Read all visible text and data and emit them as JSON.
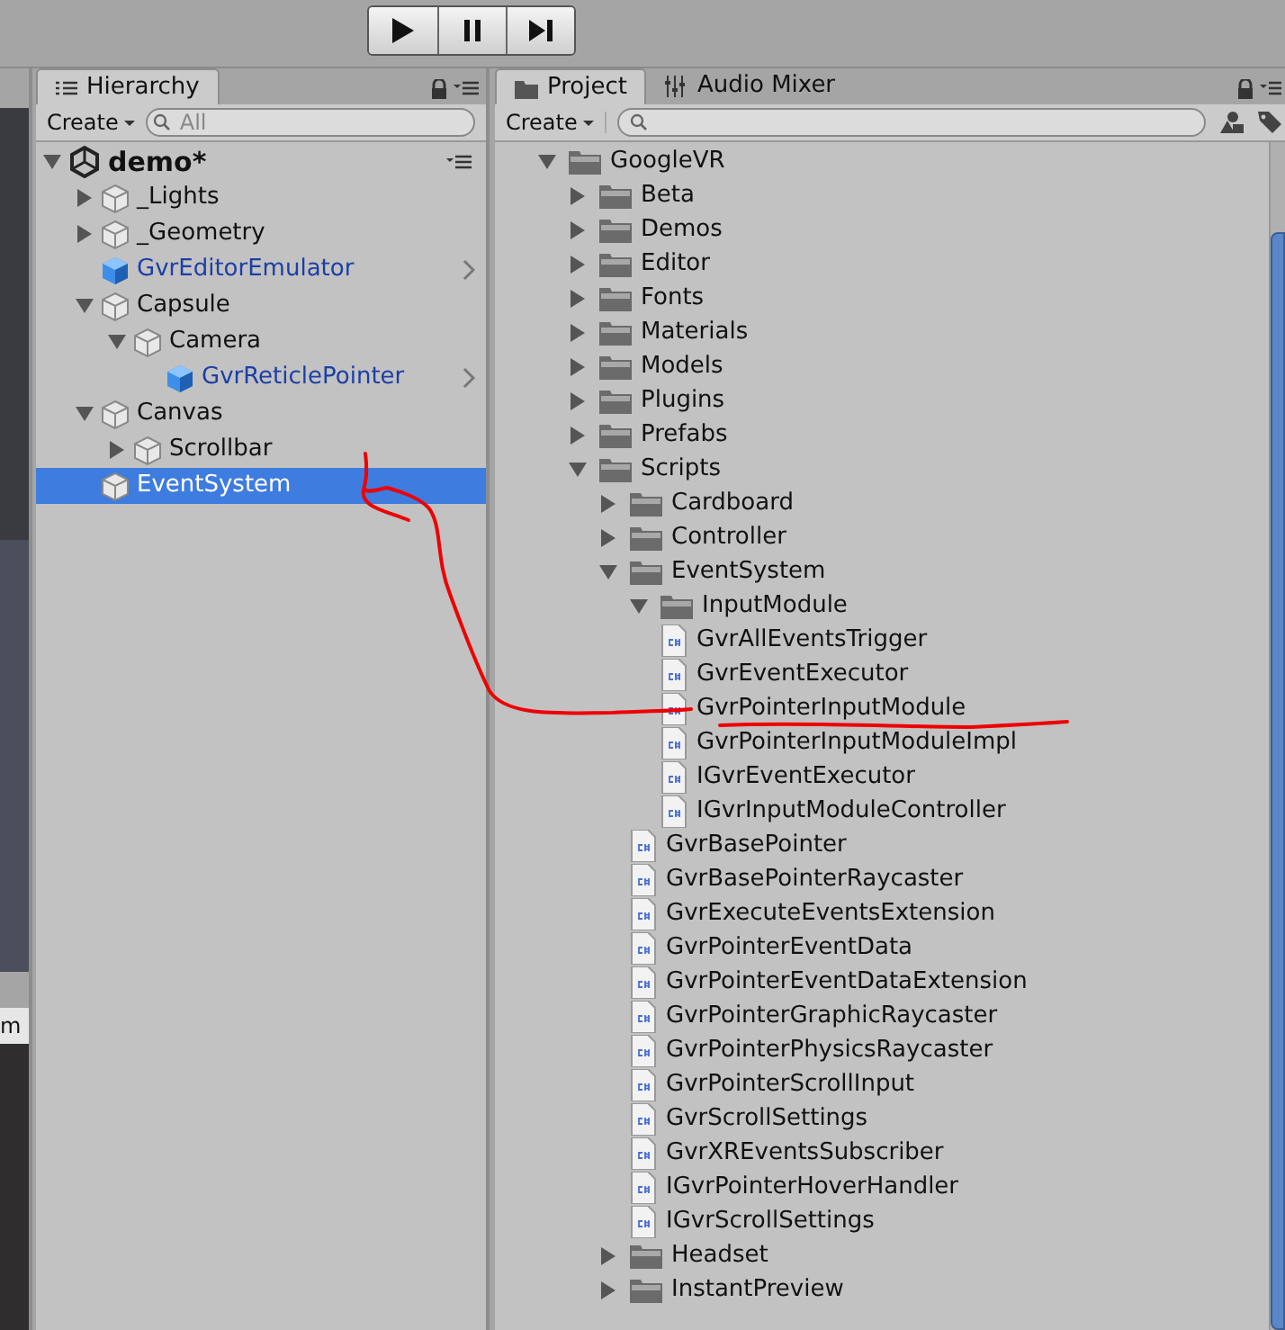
{
  "toolbar": {
    "play_controls": [
      {
        "kind": "play"
      },
      {
        "kind": "pause"
      },
      {
        "kind": "step"
      }
    ]
  },
  "scene_strip": {
    "tab_label": "m"
  },
  "hierarchy": {
    "tab": {
      "label": "Hierarchy",
      "selected": true
    },
    "create": "Create",
    "search": {
      "placeholder": "All"
    },
    "scene": {
      "name": "demo*",
      "expanded": true,
      "children": [
        {
          "name": "_Lights",
          "kind": "gameobject",
          "expanded": false,
          "selected": false
        },
        {
          "name": "_Geometry",
          "kind": "gameobject",
          "expanded": false,
          "selected": false
        },
        {
          "name": "GvrEditorEmulator",
          "kind": "prefab",
          "selected": false
        },
        {
          "name": "Capsule",
          "kind": "gameobject",
          "expanded": true,
          "selected": false,
          "children": [
            {
              "name": "Camera",
              "kind": "gameobject",
              "expanded": true,
              "selected": false,
              "children": [
                {
                  "name": "GvrReticlePointer",
                  "kind": "prefab",
                  "selected": false
                }
              ]
            }
          ]
        },
        {
          "name": "Canvas",
          "kind": "gameobject",
          "expanded": true,
          "selected": false,
          "children": [
            {
              "name": "Scrollbar",
              "kind": "gameobject",
              "expanded": false,
              "selected": false
            }
          ]
        },
        {
          "name": "EventSystem",
          "kind": "gameobject",
          "selected": true
        }
      ]
    }
  },
  "project": {
    "tabs": [
      {
        "label": "Project",
        "kind": "project",
        "selected": true
      },
      {
        "label": "Audio Mixer",
        "kind": "mixer",
        "selected": false
      }
    ],
    "create": "Create",
    "tree": [
      {
        "name": "GoogleVR",
        "kind": "folder",
        "expanded": true,
        "children": [
          {
            "name": "Beta",
            "kind": "folder",
            "expanded": false
          },
          {
            "name": "Demos",
            "kind": "folder",
            "expanded": false
          },
          {
            "name": "Editor",
            "kind": "folder",
            "expanded": false
          },
          {
            "name": "Fonts",
            "kind": "folder",
            "expanded": false
          },
          {
            "name": "Materials",
            "kind": "folder",
            "expanded": false
          },
          {
            "name": "Models",
            "kind": "folder",
            "expanded": false
          },
          {
            "name": "Plugins",
            "kind": "folder",
            "expanded": false
          },
          {
            "name": "Prefabs",
            "kind": "folder",
            "expanded": false
          },
          {
            "name": "Scripts",
            "kind": "folder",
            "expanded": true,
            "children": [
              {
                "name": "Cardboard",
                "kind": "folder",
                "expanded": false
              },
              {
                "name": "Controller",
                "kind": "folder",
                "expanded": false
              },
              {
                "name": "EventSystem",
                "kind": "folder",
                "expanded": true,
                "children": [
                  {
                    "name": "InputModule",
                    "kind": "folder",
                    "expanded": true,
                    "children": [
                      {
                        "name": "GvrAllEventsTrigger",
                        "kind": "script"
                      },
                      {
                        "name": "GvrEventExecutor",
                        "kind": "script"
                      },
                      {
                        "name": "GvrPointerInputModule",
                        "kind": "script"
                      },
                      {
                        "name": "GvrPointerInputModuleImpl",
                        "kind": "script"
                      },
                      {
                        "name": "IGvrEventExecutor",
                        "kind": "script"
                      },
                      {
                        "name": "IGvrInputModuleController",
                        "kind": "script"
                      }
                    ]
                  },
                  {
                    "name": "GvrBasePointer",
                    "kind": "script"
                  },
                  {
                    "name": "GvrBasePointerRaycaster",
                    "kind": "script"
                  },
                  {
                    "name": "GvrExecuteEventsExtension",
                    "kind": "script"
                  },
                  {
                    "name": "GvrPointerEventData",
                    "kind": "script"
                  },
                  {
                    "name": "GvrPointerEventDataExtension",
                    "kind": "script"
                  },
                  {
                    "name": "GvrPointerGraphicRaycaster",
                    "kind": "script"
                  },
                  {
                    "name": "GvrPointerPhysicsRaycaster",
                    "kind": "script"
                  },
                  {
                    "name": "GvrPointerScrollInput",
                    "kind": "script"
                  },
                  {
                    "name": "GvrScrollSettings",
                    "kind": "script"
                  },
                  {
                    "name": "GvrXREventsSubscriber",
                    "kind": "script"
                  },
                  {
                    "name": "IGvrPointerHoverHandler",
                    "kind": "script"
                  },
                  {
                    "name": "IGvrScrollSettings",
                    "kind": "script"
                  }
                ]
              },
              {
                "name": "Headset",
                "kind": "folder",
                "expanded": false
              },
              {
                "name": "InstantPreview",
                "kind": "folder",
                "expanded": false
              }
            ]
          }
        ]
      }
    ]
  }
}
